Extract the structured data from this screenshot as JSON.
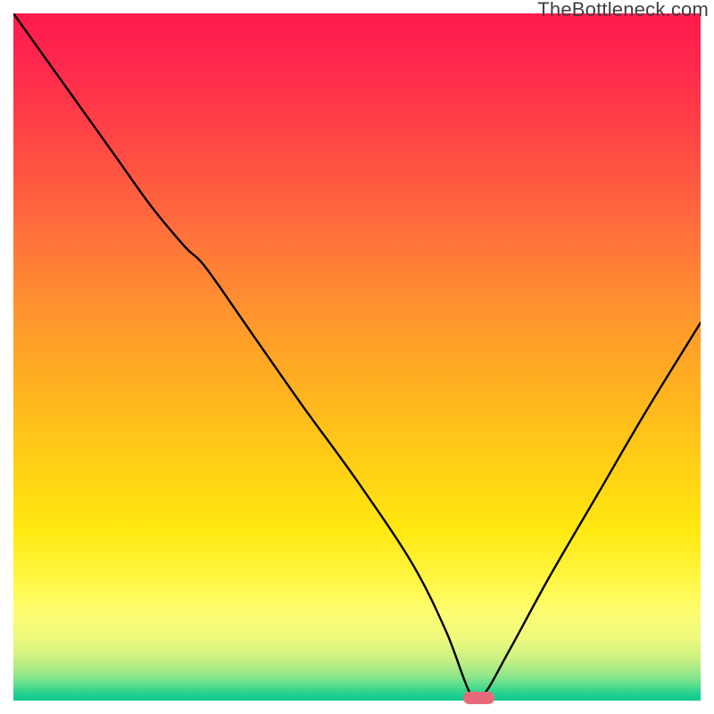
{
  "watermark": "TheBottleneck.com",
  "chart_data": {
    "type": "line",
    "title": "",
    "xlabel": "",
    "ylabel": "",
    "x": [
      0.0,
      0.05,
      0.1,
      0.15,
      0.2,
      0.25,
      0.28,
      0.35,
      0.42,
      0.5,
      0.58,
      0.63,
      0.665,
      0.685,
      0.72,
      0.78,
      0.85,
      0.92,
      1.0
    ],
    "values": [
      1.0,
      0.93,
      0.86,
      0.79,
      0.72,
      0.66,
      0.63,
      0.53,
      0.43,
      0.32,
      0.2,
      0.1,
      0.01,
      0.01,
      0.07,
      0.18,
      0.3,
      0.42,
      0.55
    ],
    "xlim": [
      0,
      1
    ],
    "ylim": [
      0,
      1
    ],
    "optimal_range": [
      0.654,
      0.7
    ],
    "gradient_colors": {
      "top": "#ff1a4d",
      "mid_upper": "#ff8a30",
      "mid": "#ffe010",
      "mid_lower": "#fdfd70",
      "bottom": "#0ec88e"
    },
    "curve_color": "#000000",
    "marker_color": "#e86a7a"
  }
}
